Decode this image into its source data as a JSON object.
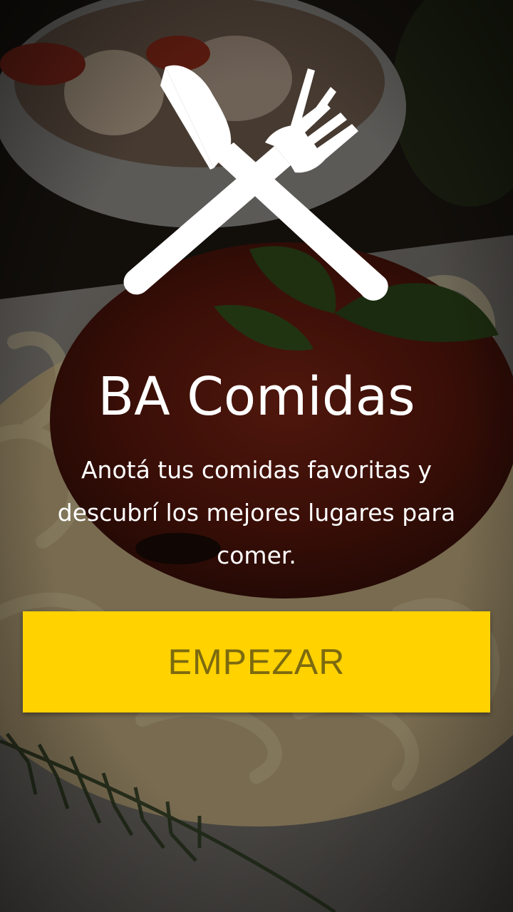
{
  "app": {
    "title": "BA Comidas",
    "subtitle": "Anotá tus comidas favoritas y descubrí los mejores lugares para comer.",
    "logo_icon": "fork-knife-icon"
  },
  "actions": {
    "start_label": "EMPEZAR"
  },
  "colors": {
    "accent": "#ffd200",
    "accent_text": "#7c6a10",
    "text": "#ffffff"
  }
}
